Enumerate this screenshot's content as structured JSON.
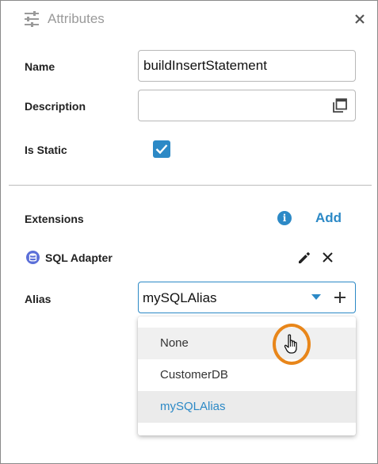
{
  "header": {
    "title": "Attributes",
    "icon": "sliders-icon",
    "close_icon": "close-icon"
  },
  "fields": {
    "name_label": "Name",
    "name_value": "buildInsertStatement",
    "description_label": "Description",
    "description_value": "",
    "is_static_label": "Is Static",
    "is_static_checked": true
  },
  "extensions": {
    "label": "Extensions",
    "add_label": "Add",
    "info_icon": "info-icon",
    "adapter_name": "SQL Adapter",
    "adapter_icon": "database-icon"
  },
  "alias": {
    "label": "Alias",
    "value": "mySQLAlias",
    "options": [
      "None",
      "CustomerDB",
      "mySQLAlias"
    ],
    "hovered_option": "None",
    "selected_option": "mySQLAlias"
  },
  "colors": {
    "accent": "#2c89c6",
    "cursor_highlight": "#e8861a"
  }
}
